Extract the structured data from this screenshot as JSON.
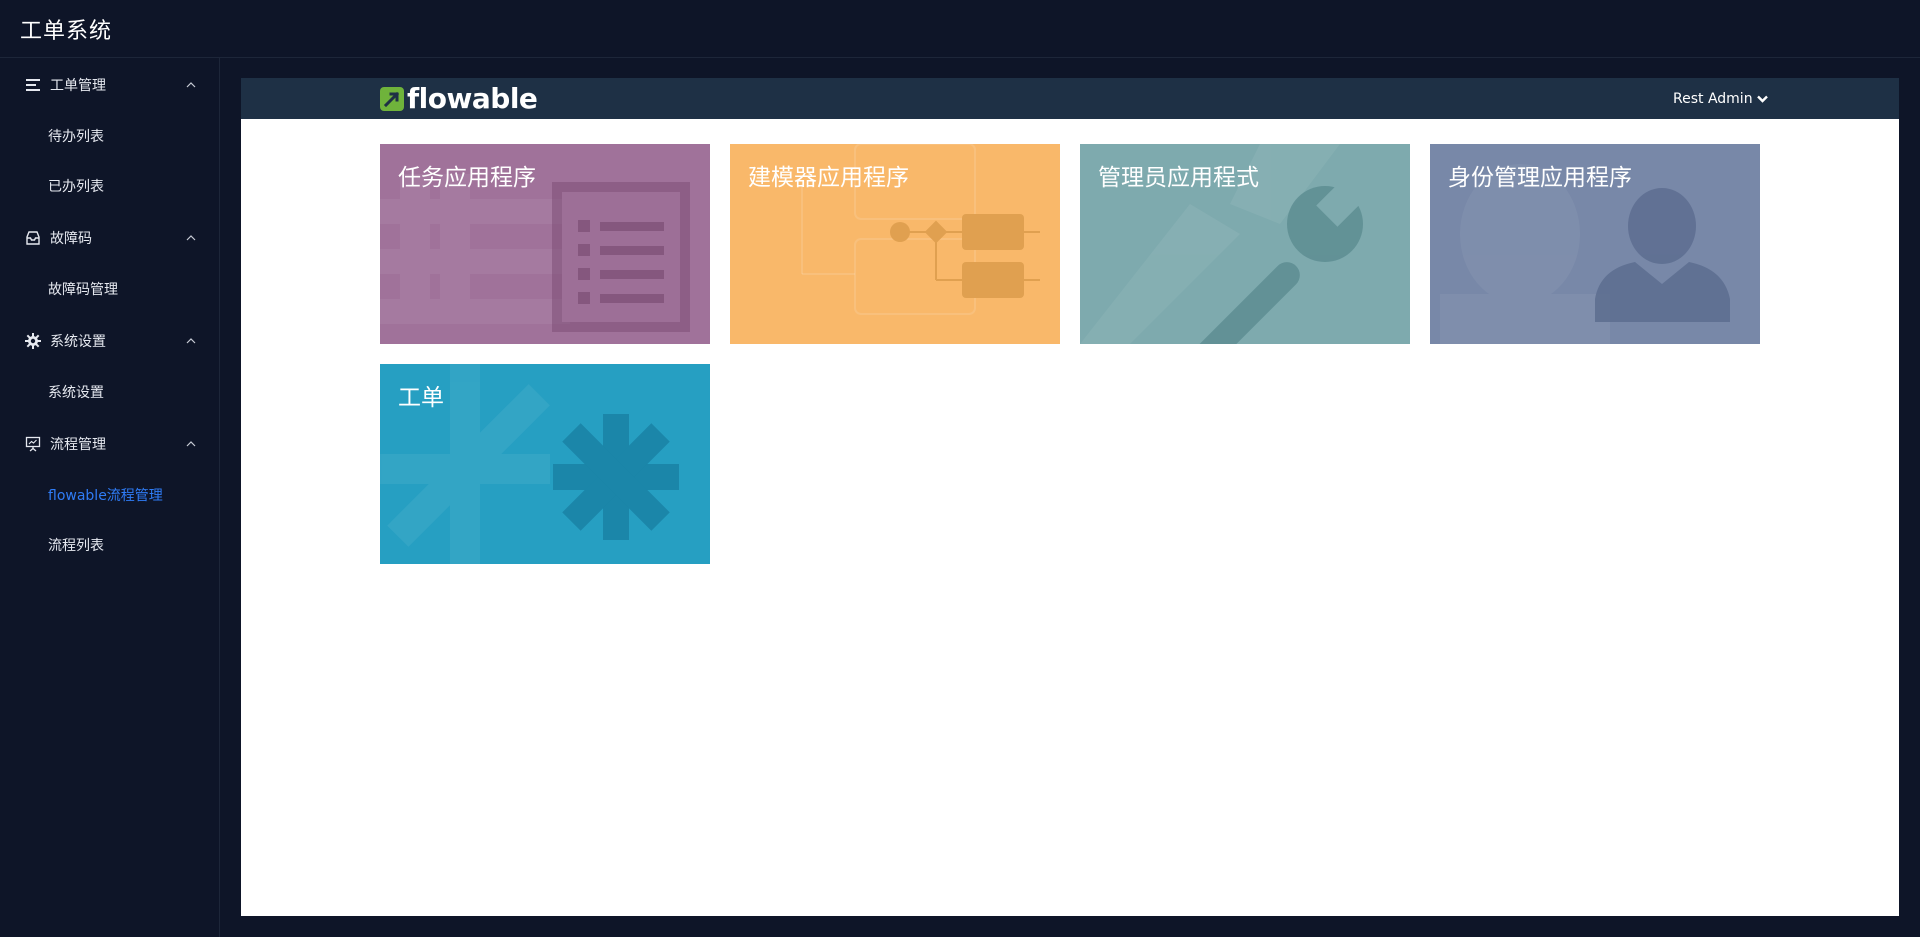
{
  "app": {
    "title": "工单系统"
  },
  "sidebar": {
    "groups": [
      {
        "label": "工单管理",
        "icon": "list-icon",
        "items": [
          {
            "label": "待办列表"
          },
          {
            "label": "已办列表"
          }
        ]
      },
      {
        "label": "故障码",
        "icon": "inbox-icon",
        "items": [
          {
            "label": "故障码管理"
          }
        ]
      },
      {
        "label": "系统设置",
        "icon": "gear-icon",
        "items": [
          {
            "label": "系统设置"
          }
        ]
      },
      {
        "label": "流程管理",
        "icon": "presentation-icon",
        "items": [
          {
            "label": "flowable流程管理",
            "active": true
          },
          {
            "label": "流程列表"
          }
        ]
      }
    ]
  },
  "flowable": {
    "logo_text": "flowable",
    "user_label": "Rest Admin",
    "tiles": [
      {
        "label": "任务应用程序",
        "color": "#a0729a",
        "icon": "task-list-icon"
      },
      {
        "label": "建模器应用程序",
        "color": "#f9b86a",
        "icon": "process-diagram-icon"
      },
      {
        "label": "管理员应用程式",
        "color": "#7eaaae",
        "icon": "wrench-icon"
      },
      {
        "label": "身份管理应用程序",
        "color": "#7888a8",
        "icon": "user-silhouette-icon"
      },
      {
        "label": "工单",
        "color": "#269fc2",
        "icon": "asterisk-icon"
      }
    ]
  },
  "colors": {
    "background": "#0e1528",
    "header_bar": "#1e3045",
    "active_menu": "#2f7cf6",
    "logo_green": "#6fb33b"
  }
}
